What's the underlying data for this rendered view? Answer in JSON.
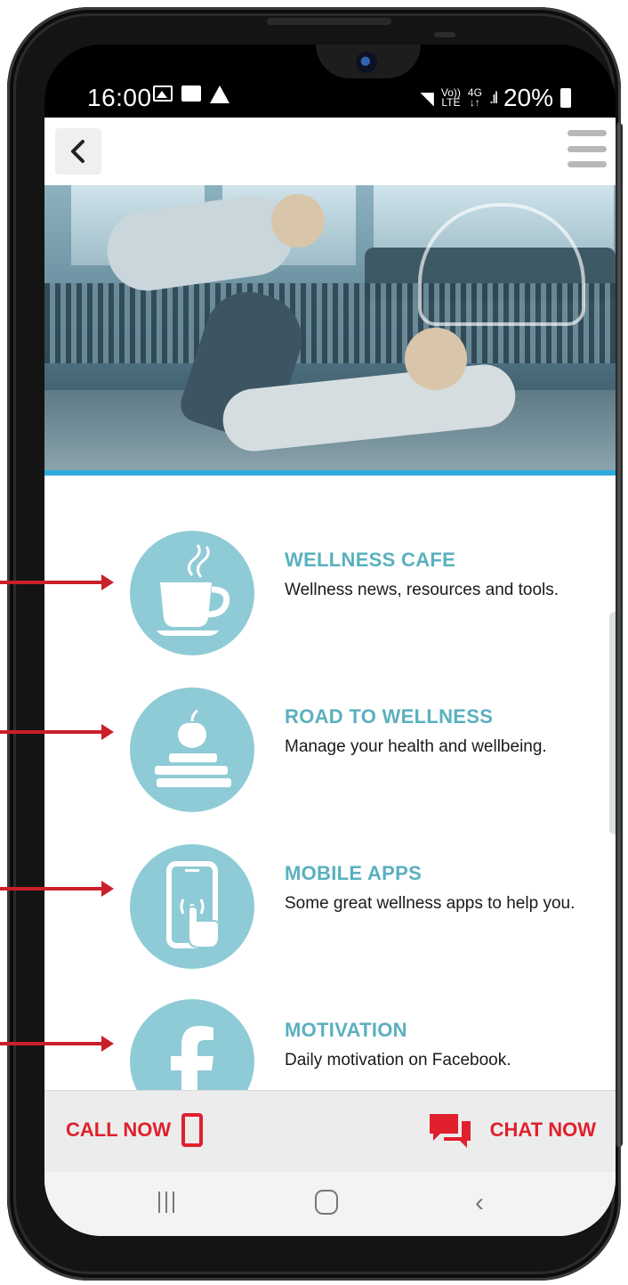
{
  "status_bar": {
    "time": "16:00",
    "signal_top": "Vo))",
    "signal_bottom": "LTE",
    "net_top": "4G",
    "net_bottom": "↓↑",
    "battery": "20%"
  },
  "items": [
    {
      "title": "WELLNESS CAFE",
      "desc": "Wellness news, resources and tools.",
      "icon": "coffee-cup-icon"
    },
    {
      "title": "ROAD TO WELLNESS",
      "desc": "Manage your health and wellbeing.",
      "icon": "apple-books-icon"
    },
    {
      "title": "MOBILE APPS",
      "desc": "Some great wellness apps to help you.",
      "icon": "phone-tap-icon"
    },
    {
      "title": "MOTIVATION",
      "desc": "Daily motivation on Facebook.",
      "icon": "facebook-icon"
    }
  ],
  "bottom_bar": {
    "call_label": "CALL NOW",
    "chat_label": "CHAT NOW"
  },
  "colors": {
    "accent_teal": "#8ecbd6",
    "title_teal": "#5ab0bf",
    "action_red": "#e0202d",
    "hero_line_blue": "#2ea9de",
    "annotation_arrow_red": "#c9202a"
  }
}
